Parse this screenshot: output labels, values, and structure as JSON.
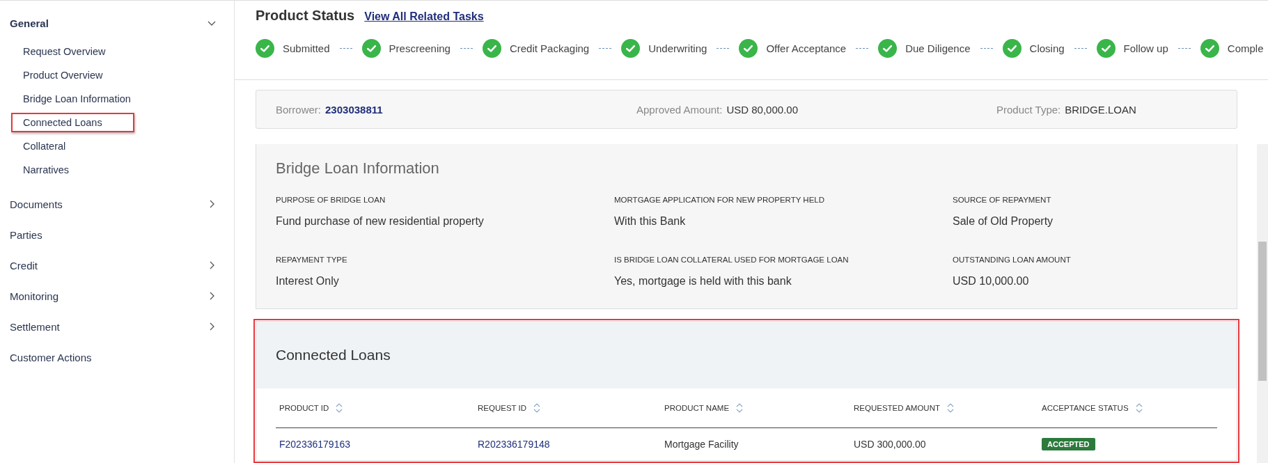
{
  "sidebar": {
    "items": [
      {
        "label": "General",
        "expandable": true,
        "expanded": true,
        "children": [
          {
            "label": "Request Overview",
            "highlighted": false
          },
          {
            "label": "Product Overview",
            "highlighted": false
          },
          {
            "label": "Bridge Loan Information",
            "highlighted": false
          },
          {
            "label": "Connected Loans",
            "highlighted": true
          },
          {
            "label": "Collateral",
            "highlighted": false
          },
          {
            "label": "Narratives",
            "highlighted": false
          }
        ]
      },
      {
        "label": "Documents",
        "expandable": true,
        "expanded": false
      },
      {
        "label": "Parties",
        "expandable": false,
        "expanded": false
      },
      {
        "label": "Credit",
        "expandable": true,
        "expanded": false
      },
      {
        "label": "Monitoring",
        "expandable": true,
        "expanded": false
      },
      {
        "label": "Settlement",
        "expandable": true,
        "expanded": false
      },
      {
        "label": "Customer Actions",
        "expandable": false,
        "expanded": false
      }
    ]
  },
  "header": {
    "title": "Product Status",
    "link": "View All Related Tasks"
  },
  "steps": [
    {
      "label": "Submitted",
      "done": true
    },
    {
      "label": "Prescreening",
      "done": true
    },
    {
      "label": "Credit Packaging",
      "done": true
    },
    {
      "label": "Underwriting",
      "done": true
    },
    {
      "label": "Offer Acceptance",
      "done": true
    },
    {
      "label": "Due Diligence",
      "done": true
    },
    {
      "label": "Closing",
      "done": true
    },
    {
      "label": "Follow up",
      "done": true
    },
    {
      "label": "Comple",
      "done": true
    }
  ],
  "summary": [
    {
      "label": "Borrower:",
      "value": "2303038811",
      "kind": "link"
    },
    {
      "label": "Approved Amount:",
      "value": "USD 80,000.00",
      "kind": "text"
    },
    {
      "label": "Product Type:",
      "value": "BRIDGE.LOAN",
      "kind": "text"
    }
  ],
  "bridge_loan": {
    "title": "Bridge Loan Information",
    "fields": [
      {
        "label": "PURPOSE OF BRIDGE LOAN",
        "value": "Fund purchase of new residential property"
      },
      {
        "label": "MORTGAGE APPLICATION FOR NEW PROPERTY HELD",
        "value": "With this Bank"
      },
      {
        "label": "SOURCE OF REPAYMENT",
        "value": "Sale of Old Property"
      },
      {
        "label": "REPAYMENT TYPE",
        "value": "Interest Only"
      },
      {
        "label": "IS BRIDGE LOAN COLLATERAL USED FOR MORTGAGE LOAN",
        "value": "Yes, mortgage is held with this bank"
      },
      {
        "label": "OUTSTANDING LOAN AMOUNT",
        "value": "USD 10,000.00"
      }
    ]
  },
  "connected_loans": {
    "title": "Connected Loans",
    "highlighted": true,
    "columns": [
      "PRODUCT ID",
      "REQUEST ID",
      "PRODUCT NAME",
      "REQUESTED AMOUNT",
      "ACCEPTANCE STATUS"
    ],
    "rows": [
      {
        "product_id": "F202336179163",
        "request_id": "R202336179148",
        "product_name": "Mortgage Facility",
        "requested_amount": "USD 300,000.00",
        "acceptance_status": "ACCEPTED"
      }
    ]
  }
}
